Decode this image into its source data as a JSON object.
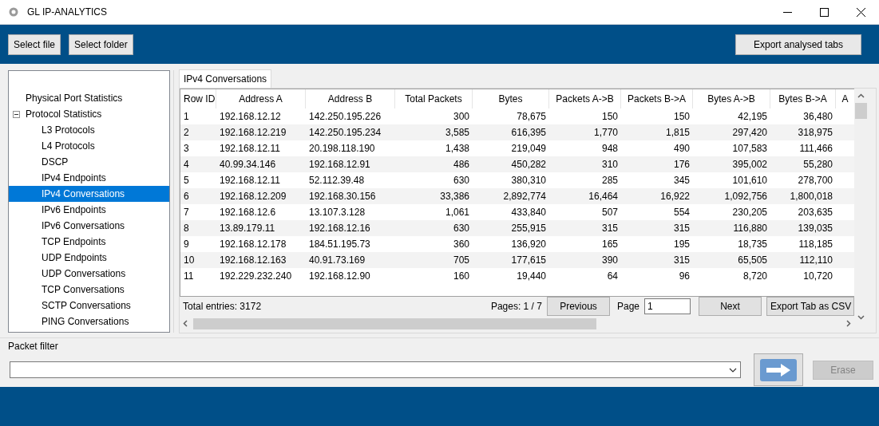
{
  "window": {
    "title": "GL IP-ANALYTICS"
  },
  "toolbar": {
    "left_buttons": [
      "Select file",
      "Select folder"
    ],
    "right_button": "Export analysed tabs"
  },
  "tree": [
    {
      "label": "Physical Port Statistics",
      "selected": false
    },
    {
      "label": "Protocol Statistics",
      "selected": false,
      "expanded": true,
      "children": [
        {
          "label": "L3 Protocols",
          "selected": false
        },
        {
          "label": "L4 Protocols",
          "selected": false
        },
        {
          "label": "DSCP",
          "selected": false
        },
        {
          "label": "IPv4 Endpoints",
          "selected": false
        },
        {
          "label": "IPv4 Conversations",
          "selected": true
        },
        {
          "label": "IPv6 Endpoints",
          "selected": false
        },
        {
          "label": "IPv6 Conversations",
          "selected": false
        },
        {
          "label": "TCP Endpoints",
          "selected": false
        },
        {
          "label": "UDP Endpoints",
          "selected": false
        },
        {
          "label": "UDP Conversations",
          "selected": false
        },
        {
          "label": "TCP Conversations",
          "selected": false
        },
        {
          "label": "SCTP Conversations",
          "selected": false
        },
        {
          "label": "PING Conversations",
          "selected": false
        }
      ]
    }
  ],
  "tabs": [
    {
      "label": "IPv4 Conversations",
      "selected": true
    }
  ],
  "table": {
    "columns": [
      "Row ID",
      "Address A",
      "Address B",
      "Total Packets",
      "Bytes",
      "Packets A->B",
      "Packets B->A",
      "Bytes A->B",
      "Bytes B->A",
      "A"
    ],
    "rows": [
      [
        "1",
        "192.168.12.12",
        "142.250.195.226",
        "300",
        "78,675",
        "150",
        "150",
        "42,195",
        "36,480"
      ],
      [
        "2",
        "192.168.12.219",
        "142.250.195.234",
        "3,585",
        "616,395",
        "1,770",
        "1,815",
        "297,420",
        "318,975"
      ],
      [
        "3",
        "192.168.12.11",
        "20.198.118.190",
        "1,438",
        "219,049",
        "948",
        "490",
        "107,583",
        "111,466"
      ],
      [
        "4",
        "40.99.34.146",
        "192.168.12.91",
        "486",
        "450,282",
        "310",
        "176",
        "395,002",
        "55,280"
      ],
      [
        "5",
        "192.168.12.11",
        "52.112.39.48",
        "630",
        "380,310",
        "285",
        "345",
        "101,610",
        "278,700"
      ],
      [
        "6",
        "192.168.12.209",
        "192.168.30.156",
        "33,386",
        "2,892,774",
        "16,464",
        "16,922",
        "1,092,756",
        "1,800,018"
      ],
      [
        "7",
        "192.168.12.6",
        "13.107.3.128",
        "1,061",
        "433,840",
        "507",
        "554",
        "230,205",
        "203,635"
      ],
      [
        "8",
        "13.89.179.11",
        "192.168.12.16",
        "630",
        "255,915",
        "315",
        "315",
        "116,880",
        "139,035"
      ],
      [
        "9",
        "192.168.12.178",
        "184.51.195.73",
        "360",
        "136,920",
        "165",
        "195",
        "18,735",
        "118,185"
      ],
      [
        "10",
        "192.168.12.163",
        "40.91.73.169",
        "705",
        "177,615",
        "390",
        "315",
        "65,505",
        "112,110"
      ],
      [
        "11",
        "192.229.232.240",
        "192.168.12.90",
        "160",
        "19,440",
        "64",
        "96",
        "8,720",
        "10,720"
      ]
    ]
  },
  "pager": {
    "total": "Total entries: 3172",
    "pages": "Pages: 1 / 7",
    "previous": "Previous",
    "page_label": "Page",
    "page_value": "1",
    "next": "Next",
    "export": "Export Tab as CSV"
  },
  "packet_filter": {
    "label": "Packet filter",
    "erase": "Erase",
    "erase_disabled": true
  }
}
